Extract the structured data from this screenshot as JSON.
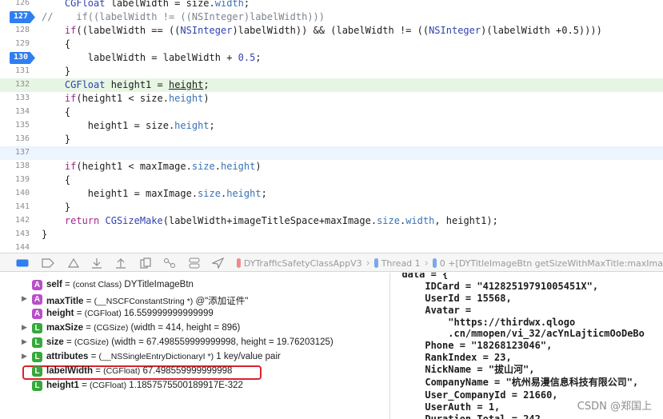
{
  "editor": {
    "lines": [
      {
        "num": "126",
        "bp": false,
        "segs": [
          [
            "    ",
            "n"
          ],
          [
            "CGFloat",
            "t"
          ],
          [
            " labelWidth = size.",
            "n"
          ],
          [
            "width",
            "p"
          ],
          [
            ";",
            "n"
          ]
        ]
      },
      {
        "num": "127",
        "bp": true,
        "segs": [
          [
            "//    if((labelWidth != ((NSInteger)labelWidth)))",
            "c"
          ]
        ]
      },
      {
        "num": "128",
        "bp": false,
        "segs": [
          [
            "    ",
            "n"
          ],
          [
            "if",
            "k"
          ],
          [
            "((labelWidth == ((",
            "n"
          ],
          [
            "NSInteger",
            "t"
          ],
          [
            ")labelWidth)) && (labelWidth != ((",
            "n"
          ],
          [
            "NSInteger",
            "t"
          ],
          [
            ")(labelWidth +0.5))))",
            "n"
          ]
        ]
      },
      {
        "num": "129",
        "bp": false,
        "segs": [
          [
            "    {",
            "n"
          ]
        ]
      },
      {
        "num": "130",
        "bp": true,
        "segs": [
          [
            "        labelWidth = labelWidth + ",
            "n"
          ],
          [
            "0.5",
            "t"
          ],
          [
            ";",
            "n"
          ]
        ]
      },
      {
        "num": "131",
        "bp": false,
        "segs": [
          [
            "    }",
            "n"
          ]
        ]
      },
      {
        "num": "132",
        "bp": false,
        "highlight": "exec",
        "segs": [
          [
            "    ",
            "n"
          ],
          [
            "CGFloat",
            "t"
          ],
          [
            " height1 = ",
            "n"
          ],
          [
            "height",
            "u"
          ],
          [
            ";",
            "n"
          ]
        ]
      },
      {
        "num": "133",
        "bp": false,
        "segs": [
          [
            "    ",
            "n"
          ],
          [
            "if",
            "k"
          ],
          [
            "(height1 < size.",
            "n"
          ],
          [
            "height",
            "p"
          ],
          [
            ")",
            "n"
          ]
        ]
      },
      {
        "num": "134",
        "bp": false,
        "segs": [
          [
            "    {",
            "n"
          ]
        ]
      },
      {
        "num": "135",
        "bp": false,
        "segs": [
          [
            "        height1 = size.",
            "n"
          ],
          [
            "height",
            "p"
          ],
          [
            ";",
            "n"
          ]
        ]
      },
      {
        "num": "136",
        "bp": false,
        "segs": [
          [
            "    }",
            "n"
          ]
        ]
      },
      {
        "num": "137",
        "bp": false,
        "highlight": "cursor",
        "segs": []
      },
      {
        "num": "138",
        "bp": false,
        "segs": [
          [
            "    ",
            "n"
          ],
          [
            "if",
            "k"
          ],
          [
            "(height1 < maxImage.",
            "n"
          ],
          [
            "size",
            "p"
          ],
          [
            ".",
            "n"
          ],
          [
            "height",
            "p"
          ],
          [
            ")",
            "n"
          ]
        ]
      },
      {
        "num": "139",
        "bp": false,
        "segs": [
          [
            "    {",
            "n"
          ]
        ]
      },
      {
        "num": "140",
        "bp": false,
        "segs": [
          [
            "        height1 = maxImage.",
            "n"
          ],
          [
            "size",
            "p"
          ],
          [
            ".",
            "n"
          ],
          [
            "height",
            "p"
          ],
          [
            ";",
            "n"
          ]
        ]
      },
      {
        "num": "141",
        "bp": false,
        "segs": [
          [
            "    }",
            "n"
          ]
        ]
      },
      {
        "num": "142",
        "bp": false,
        "segs": [
          [
            "    ",
            "n"
          ],
          [
            "return",
            "k"
          ],
          [
            " ",
            "n"
          ],
          [
            "CGSizeMake",
            "t"
          ],
          [
            "(labelWidth+imageTitleSpace+maxImage.",
            "n"
          ],
          [
            "size",
            "p"
          ],
          [
            ".",
            "n"
          ],
          [
            "width",
            "p"
          ],
          [
            ", height1);",
            "n"
          ]
        ]
      },
      {
        "num": "143",
        "bp": false,
        "segs": [
          [
            "}",
            "n"
          ]
        ]
      },
      {
        "num": "144",
        "bp": false,
        "segs": []
      }
    ]
  },
  "debug_bar": {
    "buttons": [
      "toggle-debug-area-icon",
      "breakpoints-toggle-icon",
      "continue-icon",
      "step-over-icon",
      "step-into-icon",
      "step-out-icon",
      "debug-view-hierarchy-icon",
      "memory-graph-icon",
      "environment-overrides-icon",
      "simulate-location-icon"
    ],
    "breadcrumb": {
      "target": "DYTrafficSafetyClassAppV3",
      "thread": "Thread 1",
      "frame": "0 +[DYTitleImageBtn getSizeWithMaxTitle:maxIma"
    }
  },
  "variables": [
    {
      "badge": "A",
      "expandable": false,
      "name": "self",
      "type": "(const Class)",
      "value": "DYTitleImageBtn"
    },
    {
      "badge": "A",
      "expandable": true,
      "name": "maxTitle",
      "type": "(__NSCFConstantString *)",
      "value": "@\"添加证件\""
    },
    {
      "badge": "A",
      "expandable": false,
      "name": "height",
      "type": "(CGFloat)",
      "value": "16.559999999999999"
    },
    {
      "badge": "L",
      "expandable": true,
      "name": "maxSize",
      "type": "(CGSize)",
      "value": "(width = 414, height = 896)"
    },
    {
      "badge": "L",
      "expandable": true,
      "name": "size",
      "type": "(CGSize)",
      "value": "(width = 67.498559999999998, height = 19.76203125)"
    },
    {
      "badge": "L",
      "expandable": true,
      "name": "attributes",
      "type": "(__NSSingleEntryDictionaryI *)",
      "value": "1 key/value pair"
    },
    {
      "badge": "L",
      "expandable": false,
      "name": "labelWidth",
      "type": "(CGFloat)",
      "value": "67.498559999999998"
    },
    {
      "badge": "L",
      "expandable": false,
      "name": "height1",
      "type": "(CGFloat)",
      "value": "1.1857575500189917E-322"
    }
  ],
  "console": {
    "lines": [
      "  data = {",
      "      IDCard = \"41282519791005451X\",",
      "      UserId = 15568,",
      "      Avatar =",
      "          \"https://thirdwx.qlogo",
      "          .cn/mmopen/vi_32/acYnLajticmOoDeBo",
      "      Phone = \"18268123046\",",
      "      RankIndex = 23,",
      "      NickName = \"拔山河\",",
      "      CompanyName = \"杭州易漫信息科技有限公司\",",
      "      User_CompanyId = 21660,",
      "      UserAuth = 1,",
      "      Duration_Total = 242"
    ]
  },
  "watermark": "CSDN @郑国上",
  "colors": {
    "keyword": "#a4268c",
    "type": "#2f42b0",
    "property": "#3a72b4",
    "comment": "#7b8590",
    "breakpoint": "#2f7ef2",
    "exec_line": "#e7f5e3",
    "highlight_box": "#d9232a"
  }
}
